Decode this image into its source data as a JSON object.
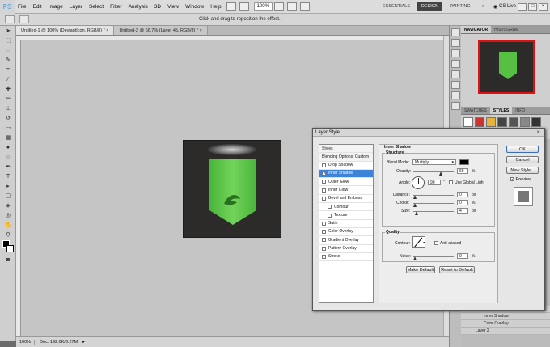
{
  "menubar": {
    "logo": "PS",
    "items": [
      "File",
      "Edit",
      "Image",
      "Layer",
      "Select",
      "Filter",
      "Analysis",
      "3D",
      "View",
      "Window",
      "Help"
    ],
    "zoom": "100%",
    "workspaces": [
      "ESSENTIALS",
      "DESIGN",
      "PAINTING"
    ],
    "active_workspace": "DESIGN",
    "cslive": "CS Live",
    "win_controls": [
      "-",
      "□",
      "×"
    ]
  },
  "optbar": {
    "hint": "Click and drag to reposition the effect."
  },
  "doc_tabs": [
    "Untitled-1 @ 100% (DeviantIcon, RGB/8) *  ×",
    "Untitled-2 @ 66.7% (Layer 45, RGB/8) *  ×"
  ],
  "status": {
    "zoom": "100%",
    "doc": "Doc: 192.0K/3.27M"
  },
  "panels": {
    "nav_tabs": [
      "NAVIGATOR",
      "HISTOGRAM"
    ],
    "style_tabs": [
      "SWATCHES",
      "STYLES",
      "INFO"
    ],
    "layers": [
      "Effects",
      "Inner Shadow",
      "Color Overlay",
      "Layer 2"
    ]
  },
  "dialog": {
    "title": "Layer Style",
    "close": "×",
    "list": [
      {
        "label": "Styles",
        "type": "header"
      },
      {
        "label": "Blending Options: Custom",
        "type": "header"
      },
      {
        "label": "Drop Shadow",
        "checked": false
      },
      {
        "label": "Inner Shadow",
        "checked": true,
        "selected": true
      },
      {
        "label": "Outer Glow",
        "checked": false
      },
      {
        "label": "Inner Glow",
        "checked": false
      },
      {
        "label": "Bevel and Emboss",
        "checked": false
      },
      {
        "label": "Contour",
        "checked": false,
        "sub": true
      },
      {
        "label": "Texture",
        "checked": false,
        "sub": true
      },
      {
        "label": "Satin",
        "checked": false
      },
      {
        "label": "Color Overlay",
        "checked": false
      },
      {
        "label": "Gradient Overlay",
        "checked": false
      },
      {
        "label": "Pattern Overlay",
        "checked": false
      },
      {
        "label": "Stroke",
        "checked": false
      }
    ],
    "section_title": "Inner Shadow",
    "structure_label": "Structure",
    "blend_mode_label": "Blend Mode:",
    "blend_mode": "Multiply",
    "opacity_label": "Opacity:",
    "opacity": "69",
    "percent": "%",
    "angle_label": "Angle:",
    "angle": "90",
    "degree": "°",
    "global_light": "Use Global Light",
    "distance_label": "Distance:",
    "distance": "0",
    "choke_label": "Choke:",
    "choke": "0",
    "size_label": "Size:",
    "size": "4",
    "px": "px",
    "quality_label": "Quality",
    "contour_label": "Contour:",
    "anti_aliased": "Anti-aliased",
    "noise_label": "Noise:",
    "noise": "0",
    "make_default": "Make Default",
    "reset_default": "Reset to Default",
    "ok": "OK",
    "cancel": "Cancel",
    "new_style": "New Style...",
    "preview": "Preview",
    "shadow_color": "#000000"
  }
}
